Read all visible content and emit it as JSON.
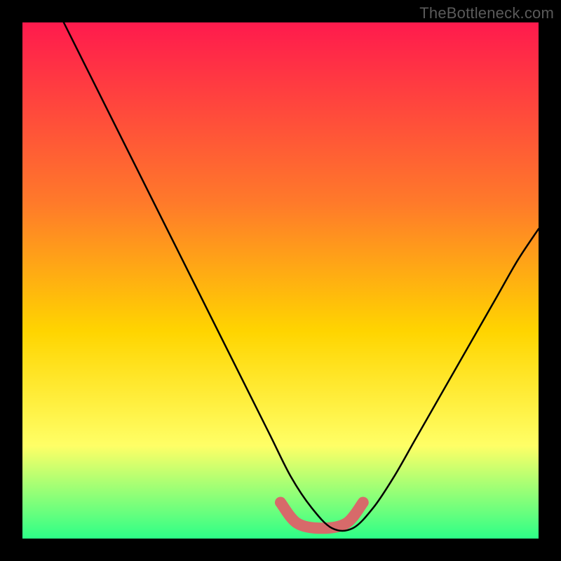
{
  "watermark": "TheBottleneck.com",
  "chart_data": {
    "type": "line",
    "title": "",
    "xlabel": "",
    "ylabel": "",
    "xlim": [
      0,
      100
    ],
    "ylim": [
      0,
      100
    ],
    "grid": false,
    "legend": false,
    "background_gradient": {
      "top": "#ff1a4d",
      "mid1": "#ff7a2a",
      "mid2": "#ffd500",
      "mid3": "#ffff66",
      "bottom": "#2dff87"
    },
    "annotations": [
      {
        "type": "highlight_segment",
        "color": "#d76a6a",
        "x_start": 50,
        "x_end": 66,
        "y": 2
      }
    ],
    "series": [
      {
        "name": "bottleneck-curve",
        "x": [
          8,
          12,
          16,
          20,
          24,
          28,
          32,
          36,
          40,
          44,
          48,
          52,
          56,
          60,
          64,
          68,
          72,
          76,
          80,
          84,
          88,
          92,
          96,
          100
        ],
        "y": [
          100,
          92,
          84,
          76,
          68,
          60,
          52,
          44,
          36,
          28,
          20,
          12,
          6,
          2,
          2,
          6,
          12,
          19,
          26,
          33,
          40,
          47,
          54,
          60
        ]
      }
    ]
  }
}
